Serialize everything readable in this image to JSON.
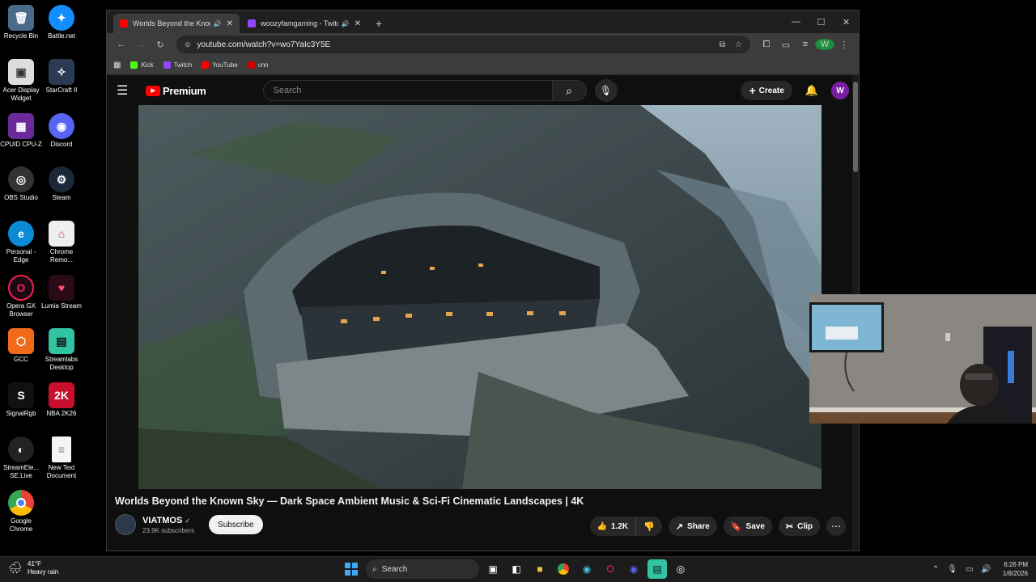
{
  "desktop": {
    "icons": [
      {
        "label": "Recycle Bin"
      },
      {
        "label": "Battle.net"
      },
      {
        "label": "Acer Display Widget"
      },
      {
        "label": "StarCraft II"
      },
      {
        "label": "CPUID CPU-Z"
      },
      {
        "label": "Discord"
      },
      {
        "label": "OBS Studio"
      },
      {
        "label": "Steam"
      },
      {
        "label": "Personal - Edge"
      },
      {
        "label": "Chrome Remo..."
      },
      {
        "label": "Opera GX Browser"
      },
      {
        "label": "Lumia Stream"
      },
      {
        "label": "GCC"
      },
      {
        "label": "Streamlabs Desktop"
      },
      {
        "label": "SignalRgb"
      },
      {
        "label": "NBA 2K26"
      },
      {
        "label": "StreamEle... SE.Live"
      },
      {
        "label": "New Text Document"
      },
      {
        "label": "Google Chrome"
      }
    ]
  },
  "browser": {
    "tabs": [
      {
        "title": "Worlds Beyond the Known",
        "active": true
      },
      {
        "title": "woozyfamgaming - Twitch",
        "active": false
      }
    ],
    "url": "youtube.com/watch?v=wo7YaIc3Y5E",
    "profile_initial": "W",
    "bookmarks": [
      {
        "label": "Kick",
        "color": "#53fc18"
      },
      {
        "label": "Twitch",
        "color": "#9146ff"
      },
      {
        "label": "YouTube",
        "color": "#ff0000"
      },
      {
        "label": "cnn",
        "color": "#cc0000"
      }
    ]
  },
  "youtube": {
    "logo_text": "Premium",
    "search_placeholder": "Search",
    "create_label": "Create",
    "avatar_initial": "W",
    "video_title": "Worlds Beyond the Known Sky — Dark Space Ambient Music & Sci-Fi Cinematic Landscapes | 4K",
    "channel_name": "VIATMOS",
    "subscribers": "23.9K subscribers",
    "subscribe_label": "Subscribe",
    "likes": "1.2K",
    "share_label": "Share",
    "save_label": "Save",
    "clip_label": "Clip"
  },
  "taskbar": {
    "weather_temp": "41°F",
    "weather_desc": "Heavy rain",
    "search_label": "Search",
    "time": "6:26 PM",
    "date": "1/8/2026"
  },
  "colors": {
    "yt_red": "#ff0000",
    "avatar_purple": "#7b1fa2"
  }
}
